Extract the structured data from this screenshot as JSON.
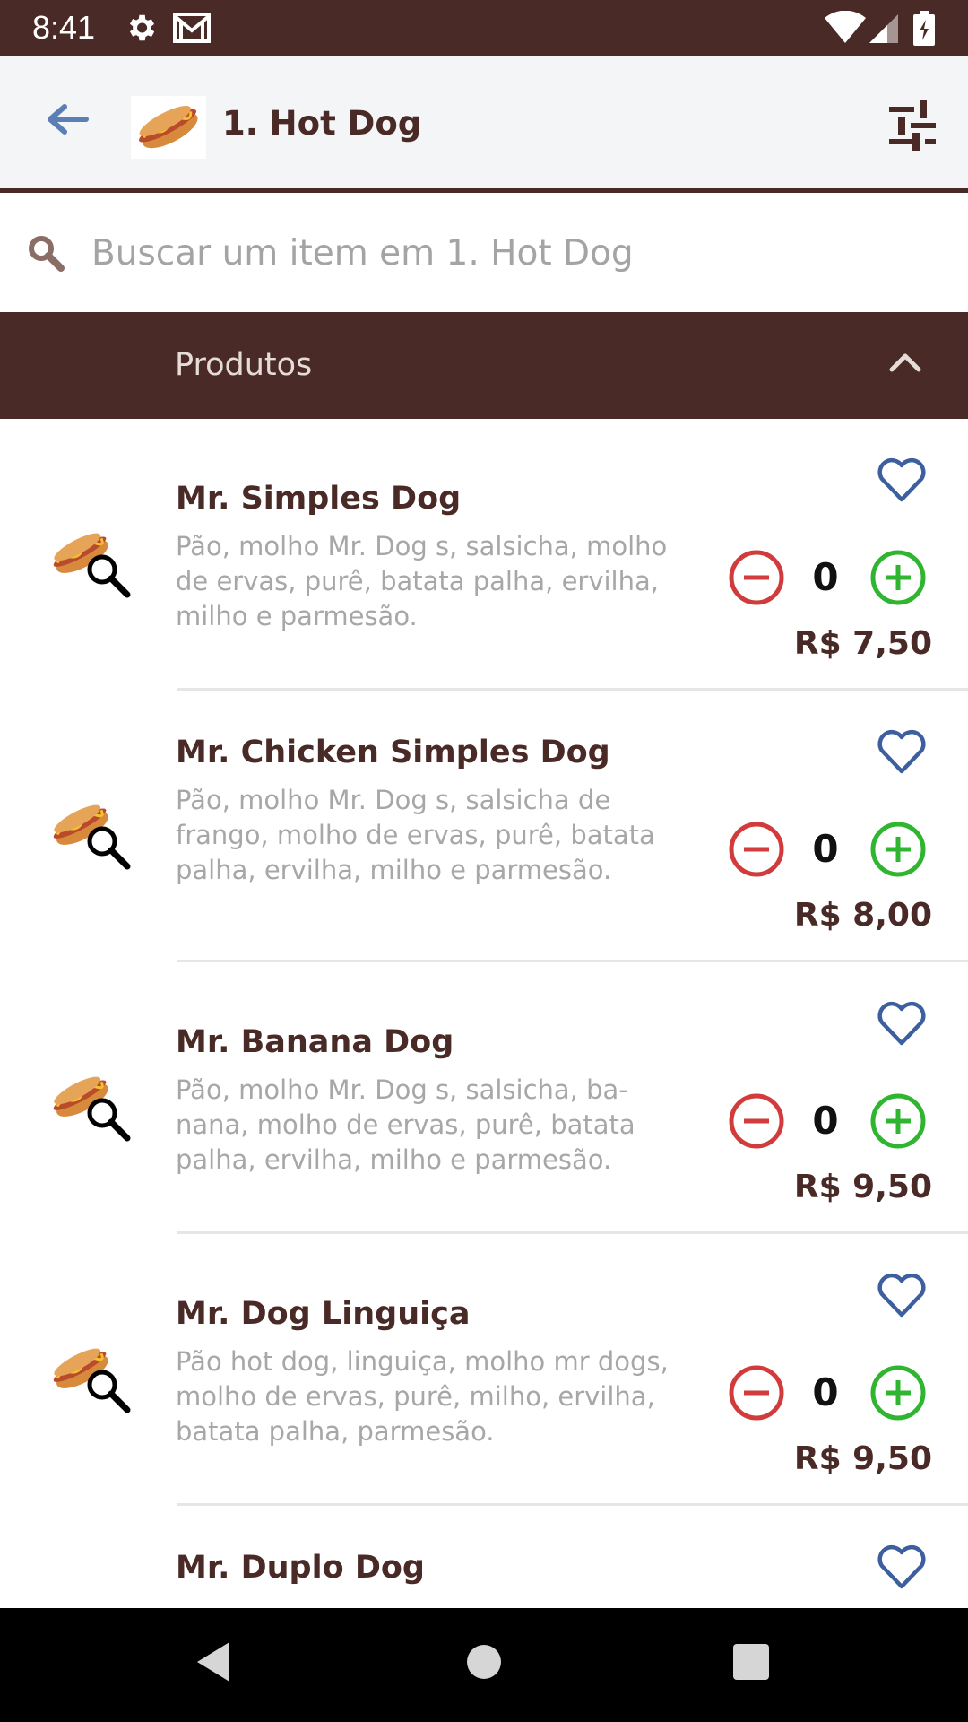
{
  "status_bar": {
    "time": "8:41",
    "left_icons": [
      "gear-icon",
      "gmail-icon"
    ],
    "right_icons": [
      "wifi-icon",
      "signal-icon",
      "battery-icon"
    ],
    "background": "#4a2a26"
  },
  "app_bar": {
    "title": "1. Hot Dog",
    "back_icon": "arrow-left-icon",
    "filter_icon": "tune-icon",
    "back_color": "#5b7fb5"
  },
  "search": {
    "placeholder": "Buscar um item em 1. Hot Dog",
    "value": ""
  },
  "section": {
    "title": "Produtos",
    "expanded": true
  },
  "products": [
    {
      "name": "Mr. Simples Dog",
      "description": "Pão, molho Mr. Dog s, salsicha, molho de ervas, purê, batata palha, ervilha, milho e parmesão.",
      "quantity": "0",
      "price": "R$ 7,50"
    },
    {
      "name": "Mr. Chicken Simples Dog",
      "description": "Pão, molho Mr. Dog s, salsicha de frango, molho de ervas, purê, batata palha, ervilha, milho e parmesão.",
      "quantity": "0",
      "price": "R$ 8,00"
    },
    {
      "name": "Mr. Banana Dog",
      "description": "Pão, molho Mr. Dog s, salsicha, ba- nana, molho de ervas, purê, batata palha, ervilha, milho e parmesão.",
      "quantity": "0",
      "price": "R$ 9,50"
    },
    {
      "name": "Mr. Dog Linguiça",
      "description": "Pão hot dog, linguiça, molho mr dogs, molho de ervas, purê, milho, ervilha, batata palha, parmesão.",
      "quantity": "0",
      "price": "R$ 9,50"
    },
    {
      "name": "Mr. Duplo Dog",
      "description": "",
      "quantity": "",
      "price": ""
    }
  ],
  "colors": {
    "brand_brown": "#4a2a26",
    "minus_red": "#d13b3b",
    "plus_green": "#2fb52f",
    "favorite_blue": "#3d5f9e"
  },
  "nav_bar": {
    "icons": [
      "back-triangle-icon",
      "home-circle-icon",
      "recents-square-icon"
    ]
  }
}
